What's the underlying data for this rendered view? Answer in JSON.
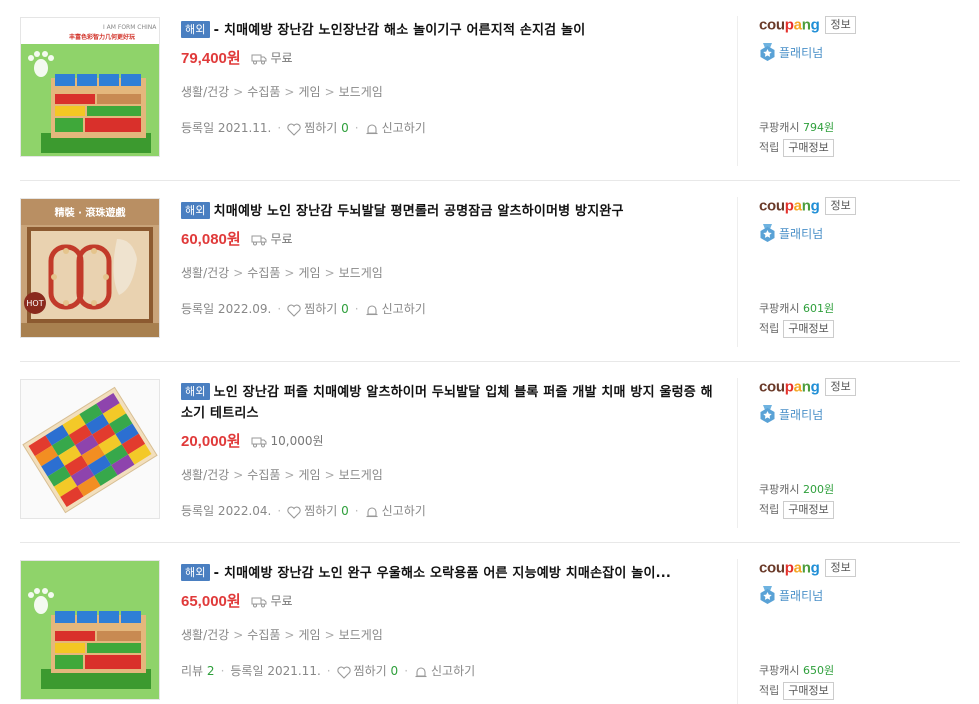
{
  "items": [
    {
      "badge": "해외",
      "title": "- 치매예방 장난감 노인장난감 해소 놀이기구 어른지적 손지검 놀이",
      "price": "79,400원",
      "shipping": "무료",
      "categories": [
        "생활/건강",
        "수집품",
        "게임",
        "보드게임"
      ],
      "review_label": "",
      "review_count": "",
      "registered": "등록일 2021.11.",
      "wish_label": "찜하기",
      "wish_count": "0",
      "report_label": "신고하기",
      "seller_logo": [
        "cou",
        "p",
        "a",
        "n",
        "g"
      ],
      "info_button": "정보",
      "grade": "플래티넘",
      "cash_label": "쿠팡캐시",
      "cash_value": "794원",
      "earn_label": "적립",
      "purchase_button": "구매정보"
    },
    {
      "badge": "해외",
      "title": "치매예방 노인 장난감 두뇌발달 평면롤러 공명잠금 알츠하이머병 방지완구",
      "price": "60,080원",
      "shipping": "무료",
      "categories": [
        "생활/건강",
        "수집품",
        "게임",
        "보드게임"
      ],
      "review_label": "",
      "review_count": "",
      "registered": "등록일 2022.09.",
      "wish_label": "찜하기",
      "wish_count": "0",
      "report_label": "신고하기",
      "seller_logo": [
        "cou",
        "p",
        "a",
        "n",
        "g"
      ],
      "info_button": "정보",
      "grade": "플래티넘",
      "cash_label": "쿠팡캐시",
      "cash_value": "601원",
      "earn_label": "적립",
      "purchase_button": "구매정보",
      "image_text": [
        "精裝 · 滾珠遊戲",
        "HOT"
      ]
    },
    {
      "badge": "해외",
      "title": "노인 장난감 퍼즐 치매예방 알츠하이머 두뇌발달 입체 블록 퍼즐 개발 치매 방지 울렁증 해소기 테트리스",
      "price": "20,000원",
      "shipping": "10,000원",
      "categories": [
        "생활/건강",
        "수집품",
        "게임",
        "보드게임"
      ],
      "review_label": "",
      "review_count": "",
      "registered": "등록일 2022.04.",
      "wish_label": "찜하기",
      "wish_count": "0",
      "report_label": "신고하기",
      "seller_logo": [
        "cou",
        "p",
        "a",
        "n",
        "g"
      ],
      "info_button": "정보",
      "grade": "플래티넘",
      "cash_label": "쿠팡캐시",
      "cash_value": "200원",
      "earn_label": "적립",
      "purchase_button": "구매정보"
    },
    {
      "badge": "해외",
      "title": "- 치매예방 장난감 노인 완구 우울해소 오락용품 어른 지능예방 치매손잡이 놀이...",
      "price": "65,000원",
      "shipping": "무료",
      "categories": [
        "생활/건강",
        "수집품",
        "게임",
        "보드게임"
      ],
      "review_label": "리뷰",
      "review_count": "2",
      "registered": "등록일 2021.11.",
      "wish_label": "찜하기",
      "wish_count": "0",
      "report_label": "신고하기",
      "seller_logo": [
        "cou",
        "p",
        "a",
        "n",
        "g"
      ],
      "info_button": "정보",
      "grade": "플래티넘",
      "cash_label": "쿠팡캐시",
      "cash_value": "650원",
      "earn_label": "적립",
      "purchase_button": "구매정보"
    }
  ],
  "colors": {
    "price": "#e03a3a",
    "badge": "#4a7fc1",
    "green": "#2e9f3b",
    "grade": "#4a90c8"
  },
  "icons": {
    "shipping": "truck-icon",
    "wish": "heart-icon",
    "report": "bell-icon",
    "grade": "medal-icon"
  }
}
